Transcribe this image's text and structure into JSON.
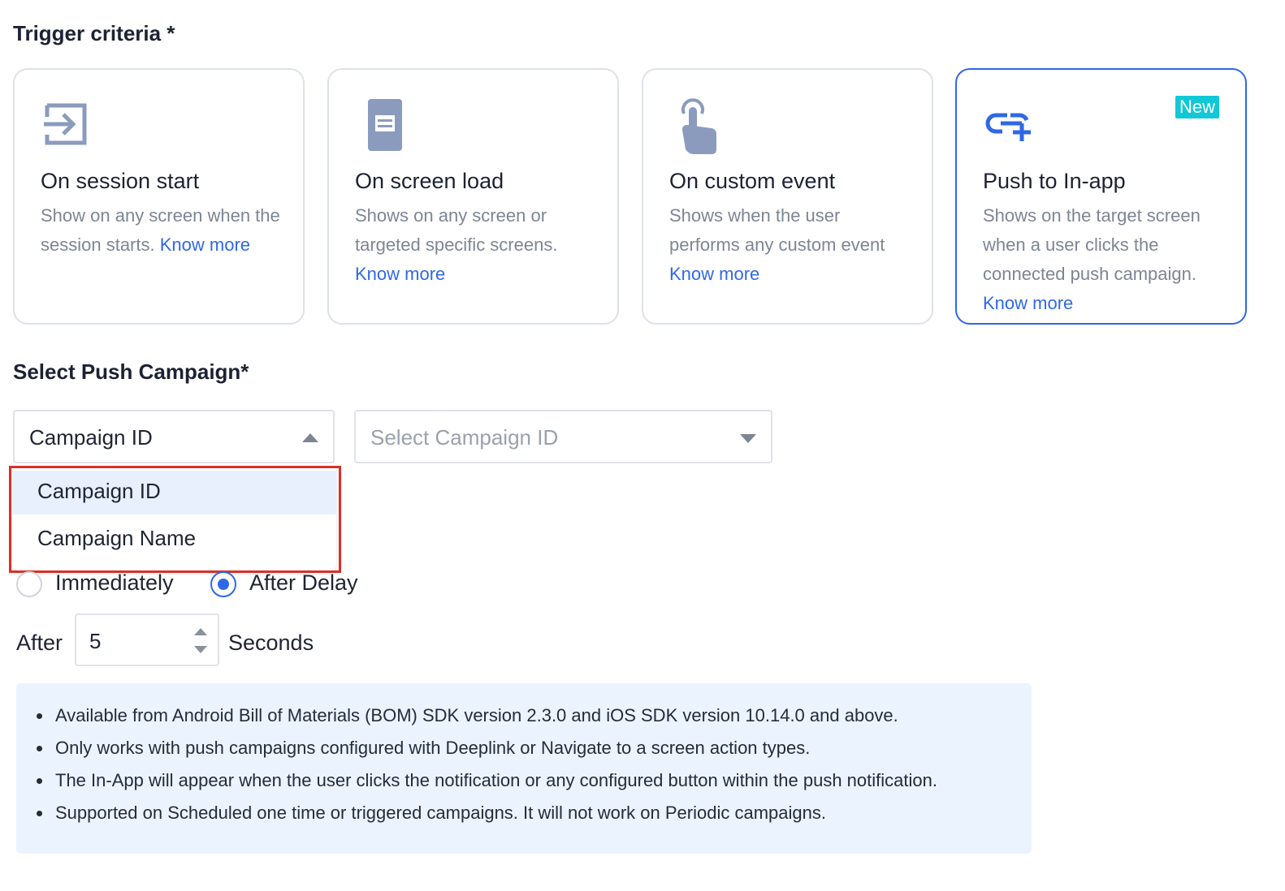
{
  "trigger_section": {
    "title": "Trigger criteria *"
  },
  "cards": [
    {
      "title": "On session start",
      "desc": "Show on any screen when the session starts.",
      "link": "Know more",
      "icon": "session-enter-icon"
    },
    {
      "title": "On screen load",
      "desc": "Shows on any screen or targeted specific screens.",
      "link": "Know more",
      "icon": "screen-document-icon"
    },
    {
      "title": "On custom event",
      "desc": "Shows when the user performs any custom event",
      "link": "Know more",
      "icon": "tap-hand-icon"
    },
    {
      "title": "Push to In-app",
      "desc": "Shows on the target screen when a user clicks the connected push campaign.",
      "link": "Know more",
      "badge": "New",
      "icon": "link-plus-icon",
      "selected": true
    }
  ],
  "push_section": {
    "title": "Select Push Campaign*",
    "type_select": {
      "value": "Campaign ID"
    },
    "id_select": {
      "placeholder": "Select Campaign ID"
    },
    "dropdown_options": [
      "Campaign ID",
      "Campaign Name"
    ]
  },
  "timing": {
    "options": [
      "Immediately",
      "After Delay"
    ],
    "selected": "After Delay",
    "after_label": "After",
    "delay_value": "5",
    "unit_label": "Seconds"
  },
  "info_notes": [
    "Available from Android Bill of Materials (BOM) SDK version 2.3.0 and iOS SDK version 10.14.0 and above.",
    "Only works with push campaigns configured with Deeplink or Navigate to a screen action types.",
    "The In-App will appear when the user clicks the notification or any configured button within the push notification.",
    "Supported on Scheduled one time or triggered campaigns. It will not work on Periodic campaigns."
  ],
  "colors": {
    "accent": "#2f68e6",
    "badge": "#12c8d6",
    "icon_gray": "#8a9bbd",
    "highlight": "#d93025",
    "info_bg": "#ebf4fe"
  }
}
